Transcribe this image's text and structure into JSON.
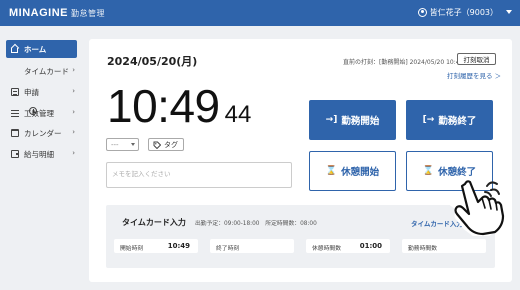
{
  "header": {
    "logo": "MINAGINE",
    "logo_sub": "勤怠管理",
    "user": "皆仁花子（9003）",
    "colors": {
      "brand": "#2f64ab"
    }
  },
  "sidebar": {
    "items": [
      {
        "label": "ホーム",
        "icon": "home-icon",
        "active": true
      },
      {
        "label": "タイムカード",
        "icon": "clock-icon"
      },
      {
        "label": "申請",
        "icon": "document-icon"
      },
      {
        "label": "工数管理",
        "icon": "list-icon"
      },
      {
        "label": "カレンダー",
        "icon": "calendar-icon"
      },
      {
        "label": "給与明細",
        "icon": "wallet-icon"
      }
    ]
  },
  "main": {
    "date": "2024/05/20(月)",
    "last_punch": "直前の打刻：[勤務開始] 2024/05/20 10:49",
    "cancel_button": "打刻取消",
    "history_link": "打刻履歴を見る ＞",
    "clock": {
      "hm": "10:49",
      "sec": "44"
    },
    "select_value": "---",
    "tag_button": "タグ",
    "memo_placeholder": "メモを記入ください",
    "buttons": {
      "clock_in": "勤務開始",
      "clock_out": "勤務終了",
      "break_start": "休憩開始",
      "break_end": "休憩終了"
    }
  },
  "timecard": {
    "title": "タイムカード入力",
    "planned": "出勤予定：09:00-18:00　所定時間数：08:00",
    "link": "タイムカード入力",
    "fields": [
      {
        "label": "開始時刻",
        "value": "10:49"
      },
      {
        "label": "終了時刻",
        "value": ""
      },
      {
        "label": "休憩時間数",
        "value": "01:00"
      },
      {
        "label": "勤務時間数",
        "value": ""
      }
    ]
  }
}
